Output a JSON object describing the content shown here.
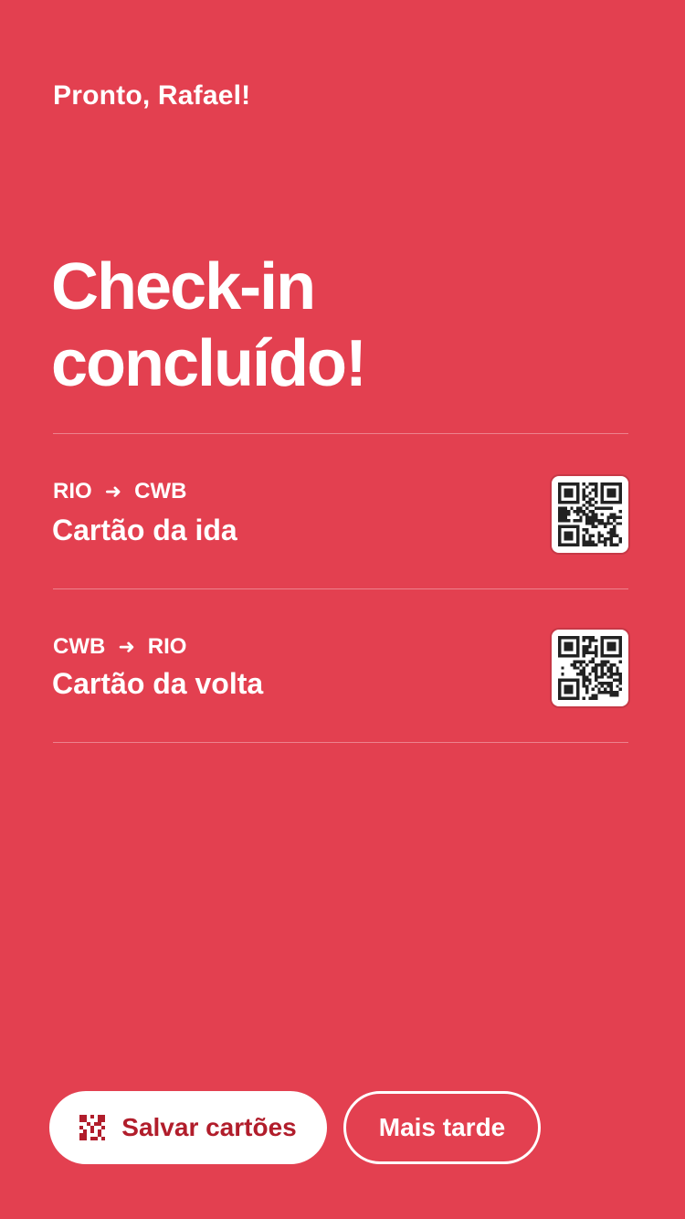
{
  "greeting": "Pronto, Rafael!",
  "title_line1": "Check-in",
  "title_line2": "concluído!",
  "cards": [
    {
      "from": "RIO",
      "to": "CWB",
      "label": "Cartão da ida",
      "qr_icon": "qr-code-icon"
    },
    {
      "from": "CWB",
      "to": "RIO",
      "label": "Cartão da volta",
      "qr_icon": "qr-code-icon"
    }
  ],
  "actions": {
    "save_label": "Salvar cartões",
    "later_label": "Mais tarde"
  },
  "colors": {
    "background": "#e34050",
    "accent_text": "#b11d2b",
    "text": "#ffffff"
  }
}
